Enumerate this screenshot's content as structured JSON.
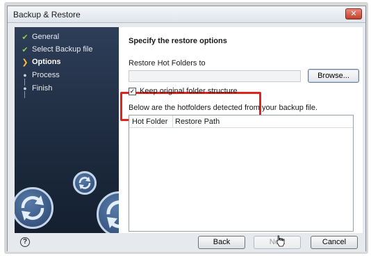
{
  "window": {
    "title": "Backup & Restore",
    "close_glyph": "✕"
  },
  "sidebar": {
    "steps": [
      {
        "label": "General",
        "state": "done",
        "marker": "✔"
      },
      {
        "label": "Select Backup file",
        "state": "done",
        "marker": "✔"
      },
      {
        "label": "Options",
        "state": "current",
        "marker": "❯"
      },
      {
        "label": "Process",
        "state": "pending",
        "marker": "●"
      },
      {
        "label": "Finish",
        "state": "pending",
        "marker": "●"
      }
    ],
    "decorative_icons": [
      "sync-icon",
      "sync-icon",
      "sync-icon"
    ]
  },
  "main": {
    "heading": "Specify the restore options",
    "restore_label": "Restore Hot Folders to",
    "path_value": "",
    "browse_label": "Browse...",
    "keep_structure_label": "Keep original folder structure",
    "keep_structure_checked": true,
    "checkbox_glyph": "✓",
    "below_label": "Below are the hotfolders detected from your backup file.",
    "table": {
      "columns": [
        "Hot Folder",
        "Restore Path"
      ],
      "rows": []
    }
  },
  "footer": {
    "help_glyph": "?",
    "back_label": "Back",
    "next_label": "Next",
    "next_enabled": false,
    "cancel_label": "Cancel"
  },
  "colors": {
    "sidebar_bg": "#1e2b40",
    "check_green": "#8fd14f",
    "current_arrow": "#f0c040",
    "highlight_red": "#e0231b",
    "close_red": "#c2402d"
  }
}
